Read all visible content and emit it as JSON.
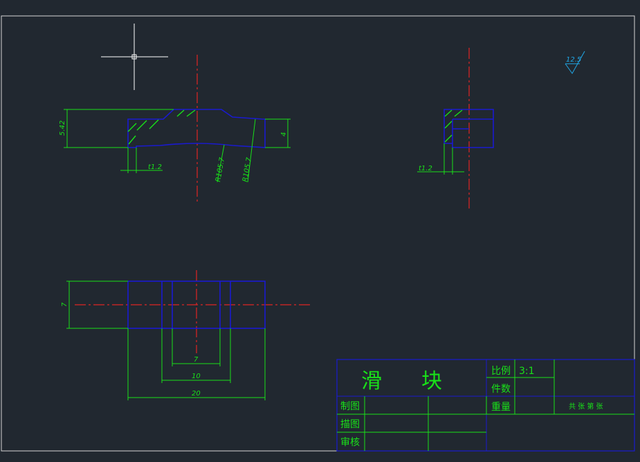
{
  "title_block": {
    "part_name_1": "滑",
    "part_name_2": "块",
    "scale_label": "比例",
    "scale_value": "3:1",
    "quantity_label": "件数",
    "weight_label": "重量",
    "sheets_text": "共  张  第  张",
    "drawn_by_label": "制图",
    "traced_by_label": "描图",
    "checked_by_label": "审核"
  },
  "dimensions": {
    "height_left": "5.42",
    "height_right": "4",
    "thickness_front": "t1.2",
    "radius_1": "R105.7",
    "radius_2": "R105.7",
    "thickness_side": "t1.2",
    "plan_height": "7",
    "plan_inner": "7",
    "plan_middle": "10",
    "plan_overall": "20"
  },
  "roughness": "12.5",
  "colors": {
    "background": "#212830",
    "outline": "#1a1ad0",
    "dimension": "#19e019",
    "centerline": "#e02424",
    "frame": "#d6d6d6",
    "roughness_symbol": "#20a8e8"
  }
}
